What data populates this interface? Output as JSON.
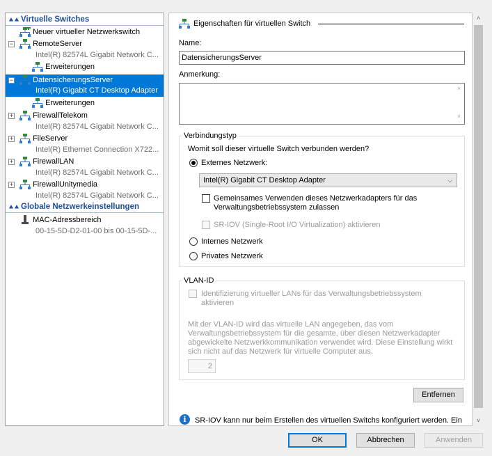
{
  "tree": {
    "section_virtual_switches": "Virtuelle Switches",
    "new_switch": "Neuer virtueller Netzwerkswitch",
    "switches": [
      {
        "name": "RemoteServer",
        "adapter": "Intel(R) 82574L Gigabit Network C...",
        "extensions": "Erweiterungen",
        "expanded": true
      },
      {
        "name": "DatensicherungsServer",
        "adapter": "Intel(R) Gigabit CT Desktop Adapter",
        "extensions": "Erweiterungen",
        "expanded": true,
        "selected": true
      },
      {
        "name": "FirewallTelekom",
        "adapter": "Intel(R) 82574L Gigabit Network C..."
      },
      {
        "name": "FileServer",
        "adapter": "Intel(R) Ethernet Connection X722..."
      },
      {
        "name": "FirewallLAN",
        "adapter": "Intel(R) 82574L Gigabit Network C..."
      },
      {
        "name": "FirewallUnitymedia",
        "adapter": "Intel(R) 82574L Gigabit Network C..."
      }
    ],
    "section_global": "Globale Netzwerkeinstellungen",
    "mac_title": "MAC-Adressbereich",
    "mac_range": "00-15-5D-D2-01-00 bis 00-15-5D-..."
  },
  "props": {
    "title": "Eigenschaften für virtuellen Switch",
    "name_label": "Name:",
    "name_value": "DatensicherungsServer",
    "note_label": "Anmerkung:",
    "note_value": "",
    "conn_group": "Verbindungstyp",
    "conn_question": "Womit soll dieser virtuelle Switch verbunden werden?",
    "external": "Externes Netzwerk:",
    "adapter_selected": "Intel(R) Gigabit CT Desktop Adapter",
    "share_line1": "Gemeinsames Verwenden dieses Netzwerkadapters für das",
    "share_line2": "Verwaltungsbetriebssystem zulassen",
    "sriov": "SR-IOV (Single-Root I/O Virtualization) aktivieren",
    "internal": "Internes Netzwerk",
    "private": "Privates Netzwerk",
    "vlan_group": "VLAN-ID",
    "vlan_check_line1": "Identifizierung virtueller LANs für das Verwaltungsbetriebssystem",
    "vlan_check_line2": "aktivieren",
    "vlan_desc_1": "Mit der VLAN-ID wird das virtuelle LAN angegeben, das vom",
    "vlan_desc_2": "Verwaltungsbetriebssystem für die gesamte, über diesen Netzwerkadapter",
    "vlan_desc_3": "abgewickelte Netzwerkkommunikation verwendet wird. Diese Einstellung wirkt",
    "vlan_desc_4": "sich nicht auf das Netzwerk für virtuelle Computer aus.",
    "vlan_value": "2",
    "remove": "Entfernen",
    "info": "SR-IOV kann nur beim Erstellen des virtuellen Switchs konfiguriert werden. Ein"
  },
  "buttons": {
    "ok": "OK",
    "cancel": "Abbrechen",
    "apply": "Anwenden"
  },
  "colors": {
    "selection": "#0078d7",
    "section_text": "#1f4e9c",
    "info": "#1e6fc9"
  }
}
